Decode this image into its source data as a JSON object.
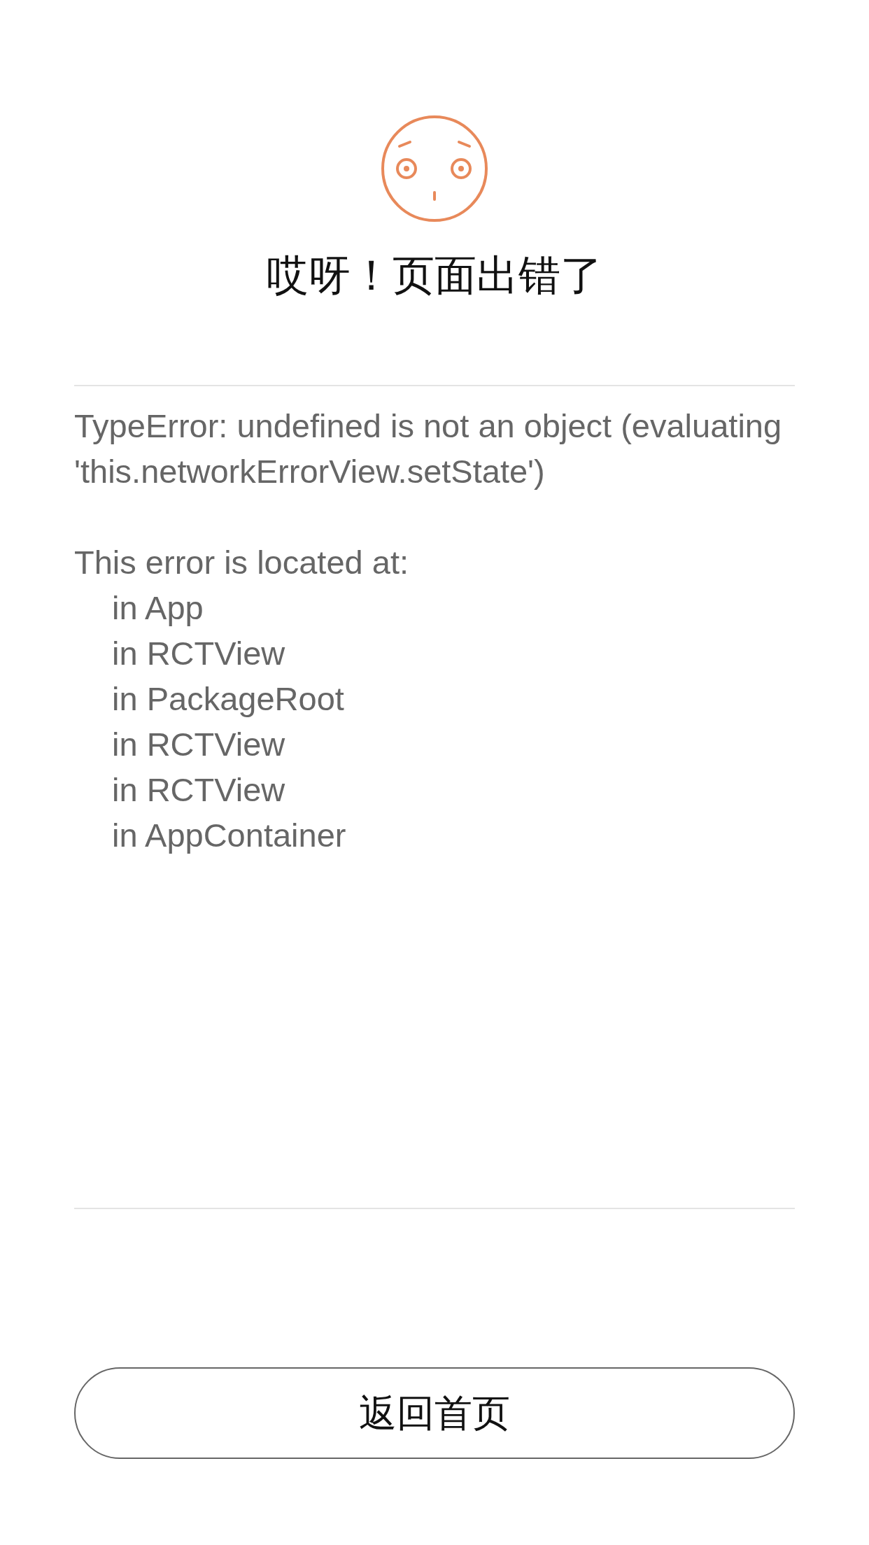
{
  "title": "哎呀！页面出错了",
  "error": {
    "message": "TypeError: undefined is not an object (evaluating 'this.networkErrorView.setState')",
    "location_header": "This error is located at:",
    "stack": [
      "in App",
      "in RCTView",
      "in PackageRoot",
      "in RCTView",
      "in RCTView",
      "in AppContainer"
    ]
  },
  "button": {
    "label": "返回首页"
  }
}
